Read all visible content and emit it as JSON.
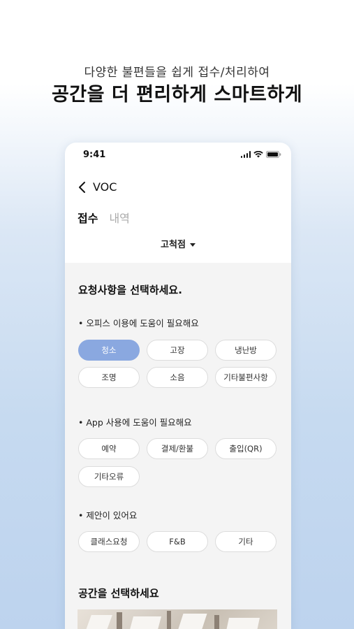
{
  "headline": {
    "sub": "다양한 불편들을 쉽게 접수/처리하여",
    "main": "공간을 더 편리하게 스마트하게"
  },
  "status_bar": {
    "time": "9:41"
  },
  "nav": {
    "title": "VOC"
  },
  "tabs": [
    {
      "label": "접수",
      "active": true
    },
    {
      "label": "내역",
      "active": false
    }
  ],
  "branch_selector": {
    "value": "고척점"
  },
  "request_section": {
    "title": "요청사항을 선택하세요.",
    "groups": [
      {
        "title": "•  오피스 이용에 도움이 필요해요",
        "options": [
          "청소",
          "고장",
          "냉난방",
          "조명",
          "소음",
          "기타불편사항"
        ],
        "selected": "청소"
      },
      {
        "title": "•  App 사용에 도움이 필요해요",
        "options": [
          "예약",
          "결제/환불",
          "출입(QR)",
          "기타오류"
        ]
      },
      {
        "title": "•  제안이 있어요",
        "options": [
          "클래스요청",
          "F&B",
          "기타"
        ]
      }
    ]
  },
  "space_section": {
    "title": "공간을 선택하세요"
  },
  "colors": {
    "accent": "#8aa8e0",
    "background_panel": "#f4f4f4"
  }
}
